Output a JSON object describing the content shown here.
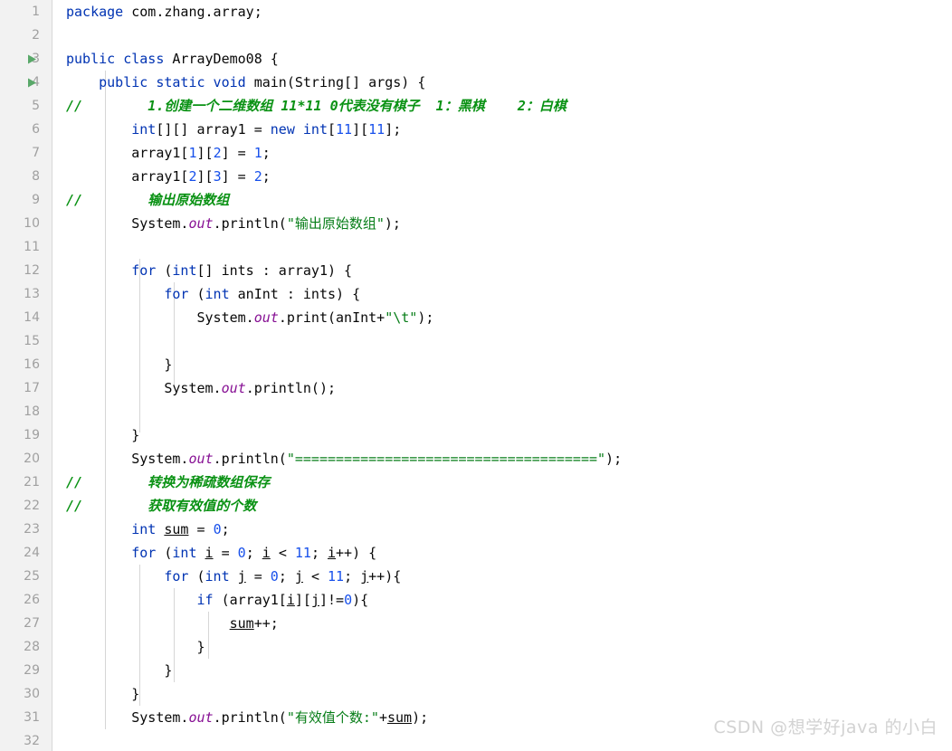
{
  "editor": {
    "language": "Java",
    "line_height": 26,
    "first_line": 1,
    "last_line": 32,
    "colors": {
      "background": "#ffffff",
      "gutter_background": "#f2f2f2",
      "keyword": "#0033b3",
      "number": "#1750eb",
      "string": "#067d17",
      "comment": "#0a9214",
      "field": "#871094",
      "text": "#080808",
      "line_number": "#a0a0a0",
      "run_marker": "#59a869",
      "indent_guide": "#d6d6d6",
      "watermark": "#d2d2d2"
    }
  },
  "gutter": {
    "line_numbers": [
      1,
      2,
      3,
      4,
      5,
      6,
      7,
      8,
      9,
      10,
      11,
      12,
      13,
      14,
      15,
      16,
      17,
      18,
      19,
      20,
      21,
      22,
      23,
      24,
      25,
      26,
      27,
      28,
      29,
      30,
      31,
      32
    ],
    "run_markers": [
      {
        "line": 3,
        "icon": "run-triangle-icon",
        "tooltip": "Run ArrayDemo08.main()"
      },
      {
        "line": 4,
        "icon": "run-triangle-icon",
        "tooltip": "Run ArrayDemo08.main()"
      }
    ],
    "fold_markers": [
      {
        "line": 4,
        "icon": "fold-collapse-icon"
      },
      {
        "line": 12,
        "icon": "fold-collapse-icon"
      },
      {
        "line": 13,
        "icon": "fold-collapse-icon"
      },
      {
        "line": 16,
        "icon": "fold-end-icon"
      },
      {
        "line": 19,
        "icon": "fold-end-icon"
      },
      {
        "line": 21,
        "icon": "fold-collapse-icon"
      },
      {
        "line": 22,
        "icon": "fold-end-icon"
      },
      {
        "line": 24,
        "icon": "fold-collapse-icon"
      },
      {
        "line": 25,
        "icon": "fold-collapse-icon"
      },
      {
        "line": 26,
        "icon": "fold-collapse-icon"
      },
      {
        "line": 28,
        "icon": "fold-end-icon"
      },
      {
        "line": 29,
        "icon": "fold-end-icon"
      },
      {
        "line": 30,
        "icon": "fold-end-icon"
      }
    ]
  },
  "code": {
    "lines": [
      {
        "n": 1,
        "text": "package com.zhang.array;"
      },
      {
        "n": 2,
        "text": ""
      },
      {
        "n": 3,
        "text": "public class ArrayDemo08 {"
      },
      {
        "n": 4,
        "text": "    public static void main(String[] args) {"
      },
      {
        "n": 5,
        "text": "//        1.创建一个二维数组 11*11 0代表没有棋子  1：黑棋    2：白棋"
      },
      {
        "n": 6,
        "text": "        int[][] array1 = new int[11][11];"
      },
      {
        "n": 7,
        "text": "        array1[1][2] = 1;"
      },
      {
        "n": 8,
        "text": "        array1[2][3] = 2;"
      },
      {
        "n": 9,
        "text": "//        输出原始数组"
      },
      {
        "n": 10,
        "text": "        System.out.println(\"输出原始数组\");"
      },
      {
        "n": 11,
        "text": ""
      },
      {
        "n": 12,
        "text": "        for (int[] ints : array1) {"
      },
      {
        "n": 13,
        "text": "            for (int anInt : ints) {"
      },
      {
        "n": 14,
        "text": "                System.out.print(anInt+\"\\t\");"
      },
      {
        "n": 15,
        "text": ""
      },
      {
        "n": 16,
        "text": "            }"
      },
      {
        "n": 17,
        "text": "            System.out.println();"
      },
      {
        "n": 18,
        "text": ""
      },
      {
        "n": 19,
        "text": "        }"
      },
      {
        "n": 20,
        "text": "        System.out.println(\"=====================================\");"
      },
      {
        "n": 21,
        "text": "//        转换为稀疏数组保存"
      },
      {
        "n": 22,
        "text": "//        获取有效值的个数"
      },
      {
        "n": 23,
        "text": "        int sum = 0;"
      },
      {
        "n": 24,
        "text": "        for (int i = 0; i < 11; i++) {"
      },
      {
        "n": 25,
        "text": "            for (int j = 0; j < 11; j++){"
      },
      {
        "n": 26,
        "text": "                if (array1[i][j]!=0){"
      },
      {
        "n": 27,
        "text": "                    sum++;"
      },
      {
        "n": 28,
        "text": "                }"
      },
      {
        "n": 29,
        "text": "            }"
      },
      {
        "n": 30,
        "text": "        }"
      },
      {
        "n": 31,
        "text": "        System.out.println(\"有效值个数:\"+sum);"
      },
      {
        "n": 32,
        "text": ""
      }
    ]
  },
  "watermark": {
    "text": "CSDN @想学好java 的小白"
  }
}
